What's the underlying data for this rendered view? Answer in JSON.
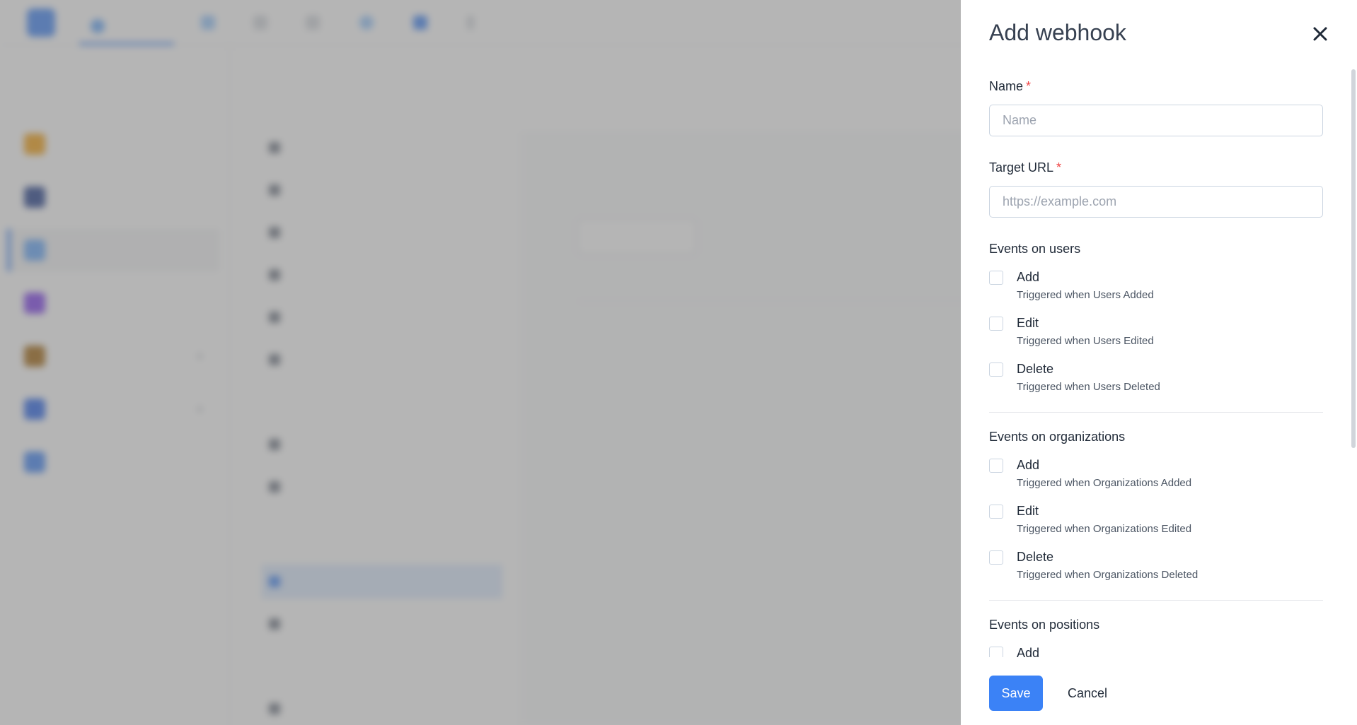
{
  "drawer": {
    "title": "Add webhook",
    "name_label": "Name",
    "name_placeholder": "Name",
    "name_value": "",
    "url_label": "Target URL",
    "url_placeholder": "https://example.com",
    "url_value": "",
    "required_mark": "*",
    "groups": [
      {
        "title": "Events on users",
        "options": [
          {
            "label": "Add",
            "desc": "Triggered when Users Added"
          },
          {
            "label": "Edit",
            "desc": "Triggered when Users Edited"
          },
          {
            "label": "Delete",
            "desc": "Triggered when Users Deleted"
          }
        ]
      },
      {
        "title": "Events on organizations",
        "options": [
          {
            "label": "Add",
            "desc": "Triggered when Organizations Added"
          },
          {
            "label": "Edit",
            "desc": "Triggered when Organizations Edited"
          },
          {
            "label": "Delete",
            "desc": "Triggered when Organizations Deleted"
          }
        ]
      },
      {
        "title": "Events on positions",
        "options": [
          {
            "label": "Add"
          }
        ]
      }
    ],
    "save_label": "Save",
    "cancel_label": "Cancel"
  },
  "icons": {
    "close": "close-icon"
  },
  "colors": {
    "accent": "#3b82f6",
    "required": "#ef4444",
    "overlay": "#787878"
  }
}
